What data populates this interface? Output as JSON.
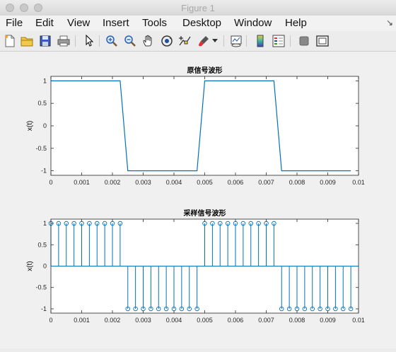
{
  "window": {
    "title": "Figure 1"
  },
  "menu": [
    "File",
    "Edit",
    "View",
    "Insert",
    "Tools",
    "Desktop",
    "Window",
    "Help"
  ],
  "toolbar": {
    "icons": [
      "new-figure-icon",
      "open-file-icon",
      "save-icon",
      "print-icon",
      "pointer-icon",
      "zoom-in-icon",
      "zoom-out-icon",
      "pan-hand-icon",
      "rotate-3d-icon",
      "data-cursor-icon",
      "brush-icon",
      "dropdown-arrow-icon",
      "link-plot-icon",
      "colorbar-icon",
      "legend-icon",
      "hide-plot-tools-icon",
      "show-plot-tools-icon"
    ]
  },
  "chart_data": [
    {
      "type": "line",
      "title": "原信号波形",
      "ylabel": "x(t)",
      "xlabel": "",
      "xlim": [
        0,
        0.01
      ],
      "ylim": [
        -1.1,
        1.1
      ],
      "xticks": [
        "0",
        "0.001",
        "0.002",
        "0.003",
        "0.004",
        "0.005",
        "0.006",
        "0.007",
        "0.008",
        "0.009",
        "0.01"
      ],
      "yticks": [
        "1",
        "0.5",
        "0",
        "-0.5",
        "-1"
      ],
      "color": "#0072bd",
      "series": [
        {
          "x": [
            0,
            0.00225,
            0.0025,
            0.00475,
            0.005,
            0.00725,
            0.0075,
            0.00975
          ],
          "y": [
            1,
            1,
            -1,
            -1,
            1,
            1,
            -1,
            -1
          ]
        }
      ]
    },
    {
      "type": "stem",
      "title": "采样信号波形",
      "ylabel": "x(t)",
      "xlabel": "",
      "xlim": [
        0,
        0.01
      ],
      "ylim": [
        -1.1,
        1.1
      ],
      "xticks": [
        "0",
        "0.001",
        "0.002",
        "0.003",
        "0.004",
        "0.005",
        "0.006",
        "0.007",
        "0.008",
        "0.009",
        "0.01"
      ],
      "yticks": [
        "1",
        "0.5",
        "0",
        "-0.5",
        "-1"
      ],
      "color": "#0072bd",
      "series": [
        {
          "x": [
            0,
            0.00025,
            0.0005,
            0.00075,
            0.001,
            0.00125,
            0.0015,
            0.00175,
            0.002,
            0.00225,
            0.0025,
            0.00275,
            0.003,
            0.00325,
            0.0035,
            0.00375,
            0.004,
            0.00425,
            0.0045,
            0.00475,
            0.005,
            0.00525,
            0.0055,
            0.00575,
            0.006,
            0.00625,
            0.0065,
            0.00675,
            0.007,
            0.00725,
            0.0075,
            0.00775,
            0.008,
            0.00825,
            0.0085,
            0.00875,
            0.009,
            0.00925,
            0.0095,
            0.00975
          ],
          "y": [
            1,
            1,
            1,
            1,
            1,
            1,
            1,
            1,
            1,
            1,
            -1,
            -1,
            -1,
            -1,
            -1,
            -1,
            -1,
            -1,
            -1,
            -1,
            1,
            1,
            1,
            1,
            1,
            1,
            1,
            1,
            1,
            1,
            -1,
            -1,
            -1,
            -1,
            -1,
            -1,
            -1,
            -1,
            -1,
            -1
          ]
        }
      ]
    }
  ]
}
